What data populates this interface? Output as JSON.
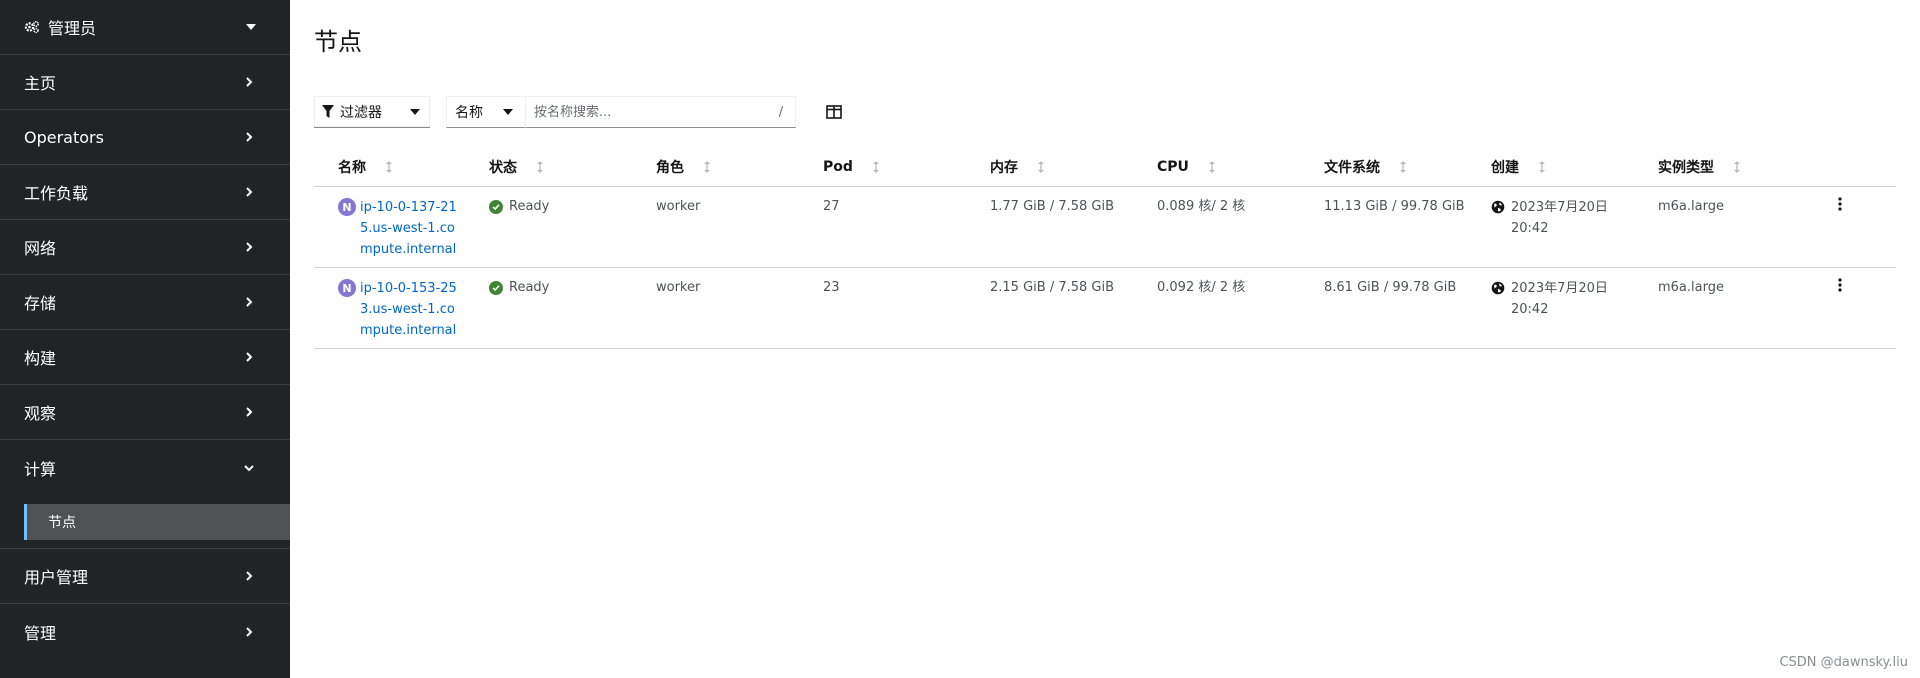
{
  "sidebar": {
    "perspective": {
      "label": "管理员",
      "icon": "cogs-icon"
    },
    "items": [
      {
        "label": "主页",
        "expanded": false
      },
      {
        "label": "Operators",
        "expanded": false
      },
      {
        "label": "工作负载",
        "expanded": false
      },
      {
        "label": "网络",
        "expanded": false
      },
      {
        "label": "存储",
        "expanded": false
      },
      {
        "label": "构建",
        "expanded": false
      },
      {
        "label": "观察",
        "expanded": false
      },
      {
        "label": "计算",
        "expanded": true,
        "children": [
          {
            "label": "节点",
            "active": true
          }
        ]
      },
      {
        "label": "用户管理",
        "expanded": false
      },
      {
        "label": "管理",
        "expanded": false
      }
    ],
    "active_color": "#73bcf7"
  },
  "main": {
    "title": "节点",
    "toolbar": {
      "filter_label": "过滤器",
      "name_select": "名称",
      "search_placeholder": "按名称搜索...",
      "search_shortcut": "/"
    },
    "table": {
      "headers": [
        "名称",
        "状态",
        "角色",
        "Pod",
        "内存",
        "CPU",
        "文件系统",
        "创建",
        "实例类型"
      ],
      "rows": [
        {
          "name": "ip-10-0-137-215.us-west-1.compute.internal",
          "badge": "N",
          "status": "Ready",
          "role": "worker",
          "pods": "27",
          "memory": "1.77 GiB / 7.58 GiB",
          "cpu": "0.089 核/ 2 核",
          "filesystem": "11.13 GiB / 99.78 GiB",
          "created_date": "2023年7月20日",
          "created_time": "20:42",
          "instance_type": "m6a.large"
        },
        {
          "name": "ip-10-0-153-253.us-west-1.compute.internal",
          "badge": "N",
          "status": "Ready",
          "role": "worker",
          "pods": "23",
          "memory": "2.15 GiB / 7.58 GiB",
          "cpu": "0.092 核/ 2 核",
          "filesystem": "8.61 GiB / 99.78 GiB",
          "created_date": "2023年7月20日",
          "created_time": "20:42",
          "instance_type": "m6a.large"
        }
      ]
    }
  },
  "watermark": "CSDN @dawnsky.liu",
  "colors": {
    "sidebar_bg": "#212427",
    "link": "#0066cc",
    "ready_green": "#3e8635",
    "node_badge": "#8476d1"
  }
}
